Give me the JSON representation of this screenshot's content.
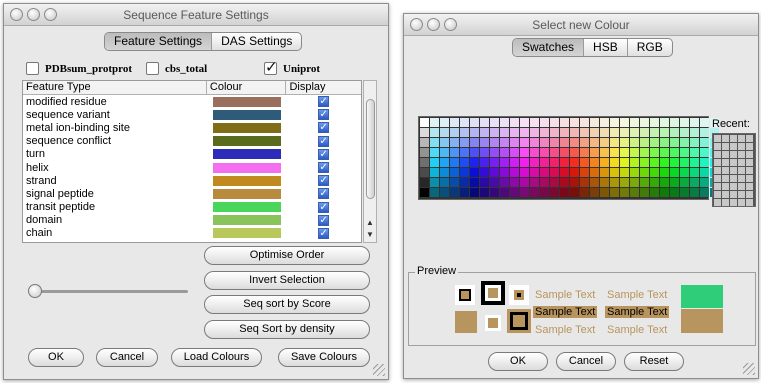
{
  "settings_window": {
    "title": "Sequence Feature Settings",
    "tabs": [
      {
        "label": "Feature Settings",
        "active": true
      },
      {
        "label": "DAS Settings",
        "active": false
      }
    ],
    "sources": [
      {
        "label": "PDBsum_protprot",
        "checked": false
      },
      {
        "label": "cbs_total",
        "checked": false
      },
      {
        "label": "Uniprot",
        "checked": true
      }
    ],
    "columns": [
      "Feature Type",
      "Colour",
      "Display"
    ],
    "features": [
      {
        "type": "modified residue",
        "colour": "#9a6f5e",
        "display": true
      },
      {
        "type": "sequence variant",
        "colour": "#2e5b7a",
        "display": true
      },
      {
        "type": "metal ion-binding site",
        "colour": "#7f6e17",
        "display": true
      },
      {
        "type": "sequence conflict",
        "colour": "#5a6b1e",
        "display": true
      },
      {
        "type": "turn",
        "colour": "#2c2cb8",
        "display": true
      },
      {
        "type": "helix",
        "colour": "#f46ef0",
        "display": true
      },
      {
        "type": "strand",
        "colour": "#c08a1e",
        "display": true
      },
      {
        "type": "signal peptide",
        "colour": "#b88a3c",
        "display": true
      },
      {
        "type": "transit peptide",
        "colour": "#49d65a",
        "display": true
      },
      {
        "type": "domain",
        "colour": "#89c35c",
        "display": true
      },
      {
        "type": "chain",
        "colour": "#b8c85a",
        "display": true
      }
    ],
    "side_buttons": [
      "Optimise Order",
      "Invert Selection",
      "Seq sort by Score",
      "Seq Sort by density"
    ],
    "bottom_buttons": [
      "OK",
      "Cancel",
      "Load Colours",
      "Save Colours"
    ]
  },
  "colour_window": {
    "title": "Select new Colour",
    "tabs": [
      {
        "label": "Swatches",
        "active": true
      },
      {
        "label": "HSB",
        "active": false
      },
      {
        "label": "RGB",
        "active": false
      }
    ],
    "recent_label": "Recent:",
    "preview_label": "Preview",
    "sample_text": "Sample Text",
    "preview_colour": "#b8955e",
    "compare_colours": [
      "#2fcc7a",
      "#b8955e"
    ],
    "buttons": [
      "OK",
      "Cancel",
      "Reset"
    ]
  }
}
